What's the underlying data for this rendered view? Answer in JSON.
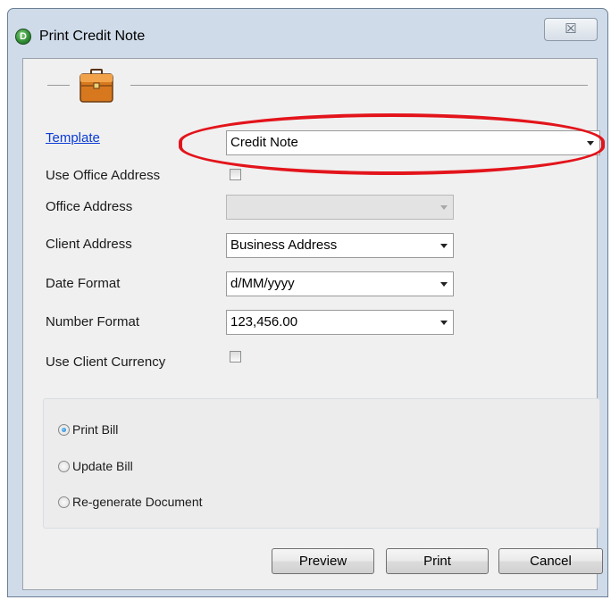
{
  "window": {
    "title": "Print Credit Note",
    "app_icon_letter": "D",
    "close_glyph": "☒"
  },
  "form": {
    "template": {
      "label": "Template",
      "value": "Credit Note"
    },
    "use_office_address": {
      "label": "Use Office Address",
      "checked": false
    },
    "office_address": {
      "label": "Office Address",
      "value": "",
      "enabled": false
    },
    "client_address": {
      "label": "Client Address",
      "value": "Business Address"
    },
    "date_format": {
      "label": "Date Format",
      "value": "d/MM/yyyy"
    },
    "number_format": {
      "label": "Number Format",
      "value": "123,456.00"
    },
    "use_client_currency": {
      "label": "Use Client Currency",
      "checked": false
    }
  },
  "options": {
    "items": [
      {
        "label": "Print Bill",
        "selected": true
      },
      {
        "label": "Update Bill",
        "selected": false
      },
      {
        "label": "Re-generate Document",
        "selected": false
      }
    ]
  },
  "buttons": {
    "preview": "Preview",
    "print": "Print",
    "cancel": "Cancel"
  },
  "colors": {
    "highlight": "#e3141b",
    "link": "#0b3bd6"
  },
  "icons": {
    "header": "briefcase-icon",
    "app": "app-logo-icon"
  }
}
